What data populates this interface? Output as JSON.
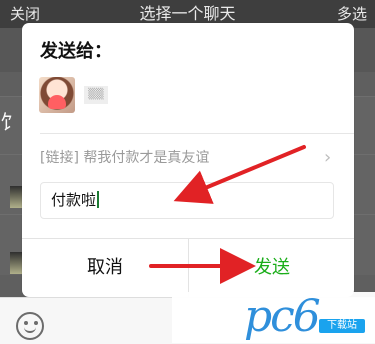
{
  "top_bar": {
    "close_label": "关闭",
    "title": "选择一个聊天",
    "multi_select_label": "多选"
  },
  "background": {
    "obscured_list_char": "饣"
  },
  "dialog": {
    "title": "发送给：",
    "recipient_name": "▒▒",
    "link_text": "[链接] 帮我付款才是真友谊",
    "message_value": "付款啦",
    "cancel_label": "取消",
    "send_label": "发送"
  },
  "watermark": {
    "logo_text": "pc6",
    "badge_text": "下载站"
  },
  "icons": {
    "emoji": "smiley-icon",
    "avatar": "avatar",
    "chevron": "chevron-right-icon"
  },
  "colors": {
    "accent_green": "#1aad19",
    "annotation_red": "#e12225",
    "watermark_blue": "#2f8fdb"
  }
}
